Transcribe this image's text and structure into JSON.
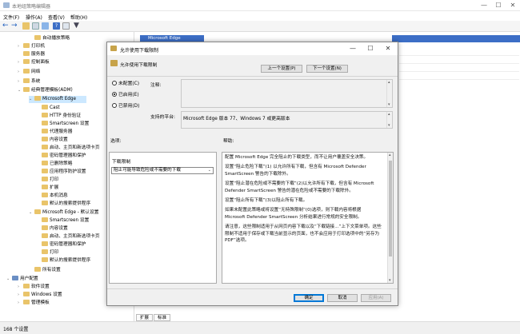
{
  "window": {
    "title": "本地组策略编辑器",
    "menu": [
      "文件(F)",
      "操作(A)",
      "查看(V)",
      "帮助(H)"
    ],
    "controls": [
      "—",
      "☐",
      "✕"
    ]
  },
  "tree": [
    {
      "label": "自动播放策略",
      "arrow": "",
      "folder": true
    },
    {
      "label": "打印机",
      "arrow": "›",
      "folder": true
    },
    {
      "label": "服务器",
      "arrow": "",
      "folder": true
    },
    {
      "label": "控制面板",
      "arrow": "›",
      "folder": true
    },
    {
      "label": "网络",
      "arrow": "›",
      "folder": true
    },
    {
      "label": "系统",
      "arrow": "›",
      "folder": true
    },
    {
      "label": "经典管理模板(ADM)",
      "arrow": "⌄",
      "folder": true
    },
    {
      "label": "Microsoft Edge",
      "arrow": "⌄",
      "folder": true,
      "selected": true
    },
    {
      "label": "Cast",
      "arrow": "",
      "folder": true
    },
    {
      "label": "HTTP 身份验证",
      "arrow": "",
      "folder": true
    },
    {
      "label": "Smartscreen 设置",
      "arrow": "",
      "folder": true
    },
    {
      "label": "代理服务器",
      "arrow": "",
      "folder": true
    },
    {
      "label": "内容设置",
      "arrow": "",
      "folder": true
    },
    {
      "label": "启动、主页和新选项卡页",
      "arrow": "",
      "folder": true
    },
    {
      "label": "密码管理器和保护",
      "arrow": "",
      "folder": true
    },
    {
      "label": "已删除策略",
      "arrow": "",
      "folder": true
    },
    {
      "label": "应用程序防护设置",
      "arrow": "",
      "folder": true
    },
    {
      "label": "打印",
      "arrow": "",
      "folder": true
    },
    {
      "label": "扩展",
      "arrow": "",
      "folder": true
    },
    {
      "label": "本机消息",
      "arrow": "",
      "folder": true
    },
    {
      "label": "默认的搜索提供程序",
      "arrow": "",
      "folder": true
    },
    {
      "label": "Microsoft Edge - 默认设置",
      "arrow": "⌄",
      "folder": true
    },
    {
      "label": "Smartscreen 设置",
      "arrow": "",
      "folder": true
    },
    {
      "label": "内容设置",
      "arrow": "",
      "folder": true
    },
    {
      "label": "启动、主页和新选项卡页",
      "arrow": "",
      "folder": true
    },
    {
      "label": "密码管理器和保护",
      "arrow": "",
      "folder": true
    },
    {
      "label": "打印",
      "arrow": "",
      "folder": true
    },
    {
      "label": "默认的搜索提供程序",
      "arrow": "",
      "folder": true
    },
    {
      "label": "所有设置",
      "arrow": "",
      "folder": true
    },
    {
      "label": "用户配置",
      "arrow": "⌄",
      "folder": false
    },
    {
      "label": "软件设置",
      "arrow": "›",
      "folder": true
    },
    {
      "label": "Windows 设置",
      "arrow": "›",
      "folder": true
    },
    {
      "label": "管理模板",
      "arrow": "›",
      "folder": true
    }
  ],
  "right_pane": {
    "header": "Microsoft Edge"
  },
  "tabs": [
    "扩展",
    "标准"
  ],
  "status": "168 个设置",
  "dialog": {
    "title": "允许使用下载限制",
    "subtitle": "允许使用下载限制",
    "prev_button": "上一个设置(P)",
    "next_button": "下一个设置(N)",
    "radios": [
      {
        "label": "未配置(C)",
        "checked": false
      },
      {
        "label": "已启用(E)",
        "checked": true
      },
      {
        "label": "已禁用(D)",
        "checked": false
      }
    ],
    "comment_label": "注释:",
    "platform_label": "支持的平台:",
    "platform_text": "Microsoft Edge 版本 77、Windows 7 或更高版本",
    "options_label": "选项:",
    "help_label": "帮助:",
    "options_title": "下载限制",
    "dropdown_value": "阻止可能导致危险或不需要的下载",
    "help_paragraphs": [
      "配置 Microsoft Edge 完全阻止的下载类型，而不让用户覆盖安全决策。",
      "设置“阻止危险下载”(1) 以允许所有下载，但含有 Microsoft Defender SmartScreen 警告的下载除外。",
      "设置“阻止潜在危险或不需要的下载”(2)以允许所有下载，但含有 Microsoft Defender SmartScreen 警告的潜在危险或不需要的下载除外。",
      "设置“阻止所有下载”(3)以阻止所有下载。",
      "如果未配置此策略或将设置“无特殊限制”(0)选项，则下载内容将根据 Microsoft Defender SmartScreen 分析结果进行常规的安全限制。",
      "请注意，这些限制适用于从网页内容下载以及“下载链接...”上下文菜单项。这些限制不适用于保存或下载当前显示的页面，也不会应用于打印选项中的“另存为 PDF”选项。"
    ],
    "ok_button": "确定",
    "cancel_button": "取消",
    "apply_button": "应用(A)"
  }
}
